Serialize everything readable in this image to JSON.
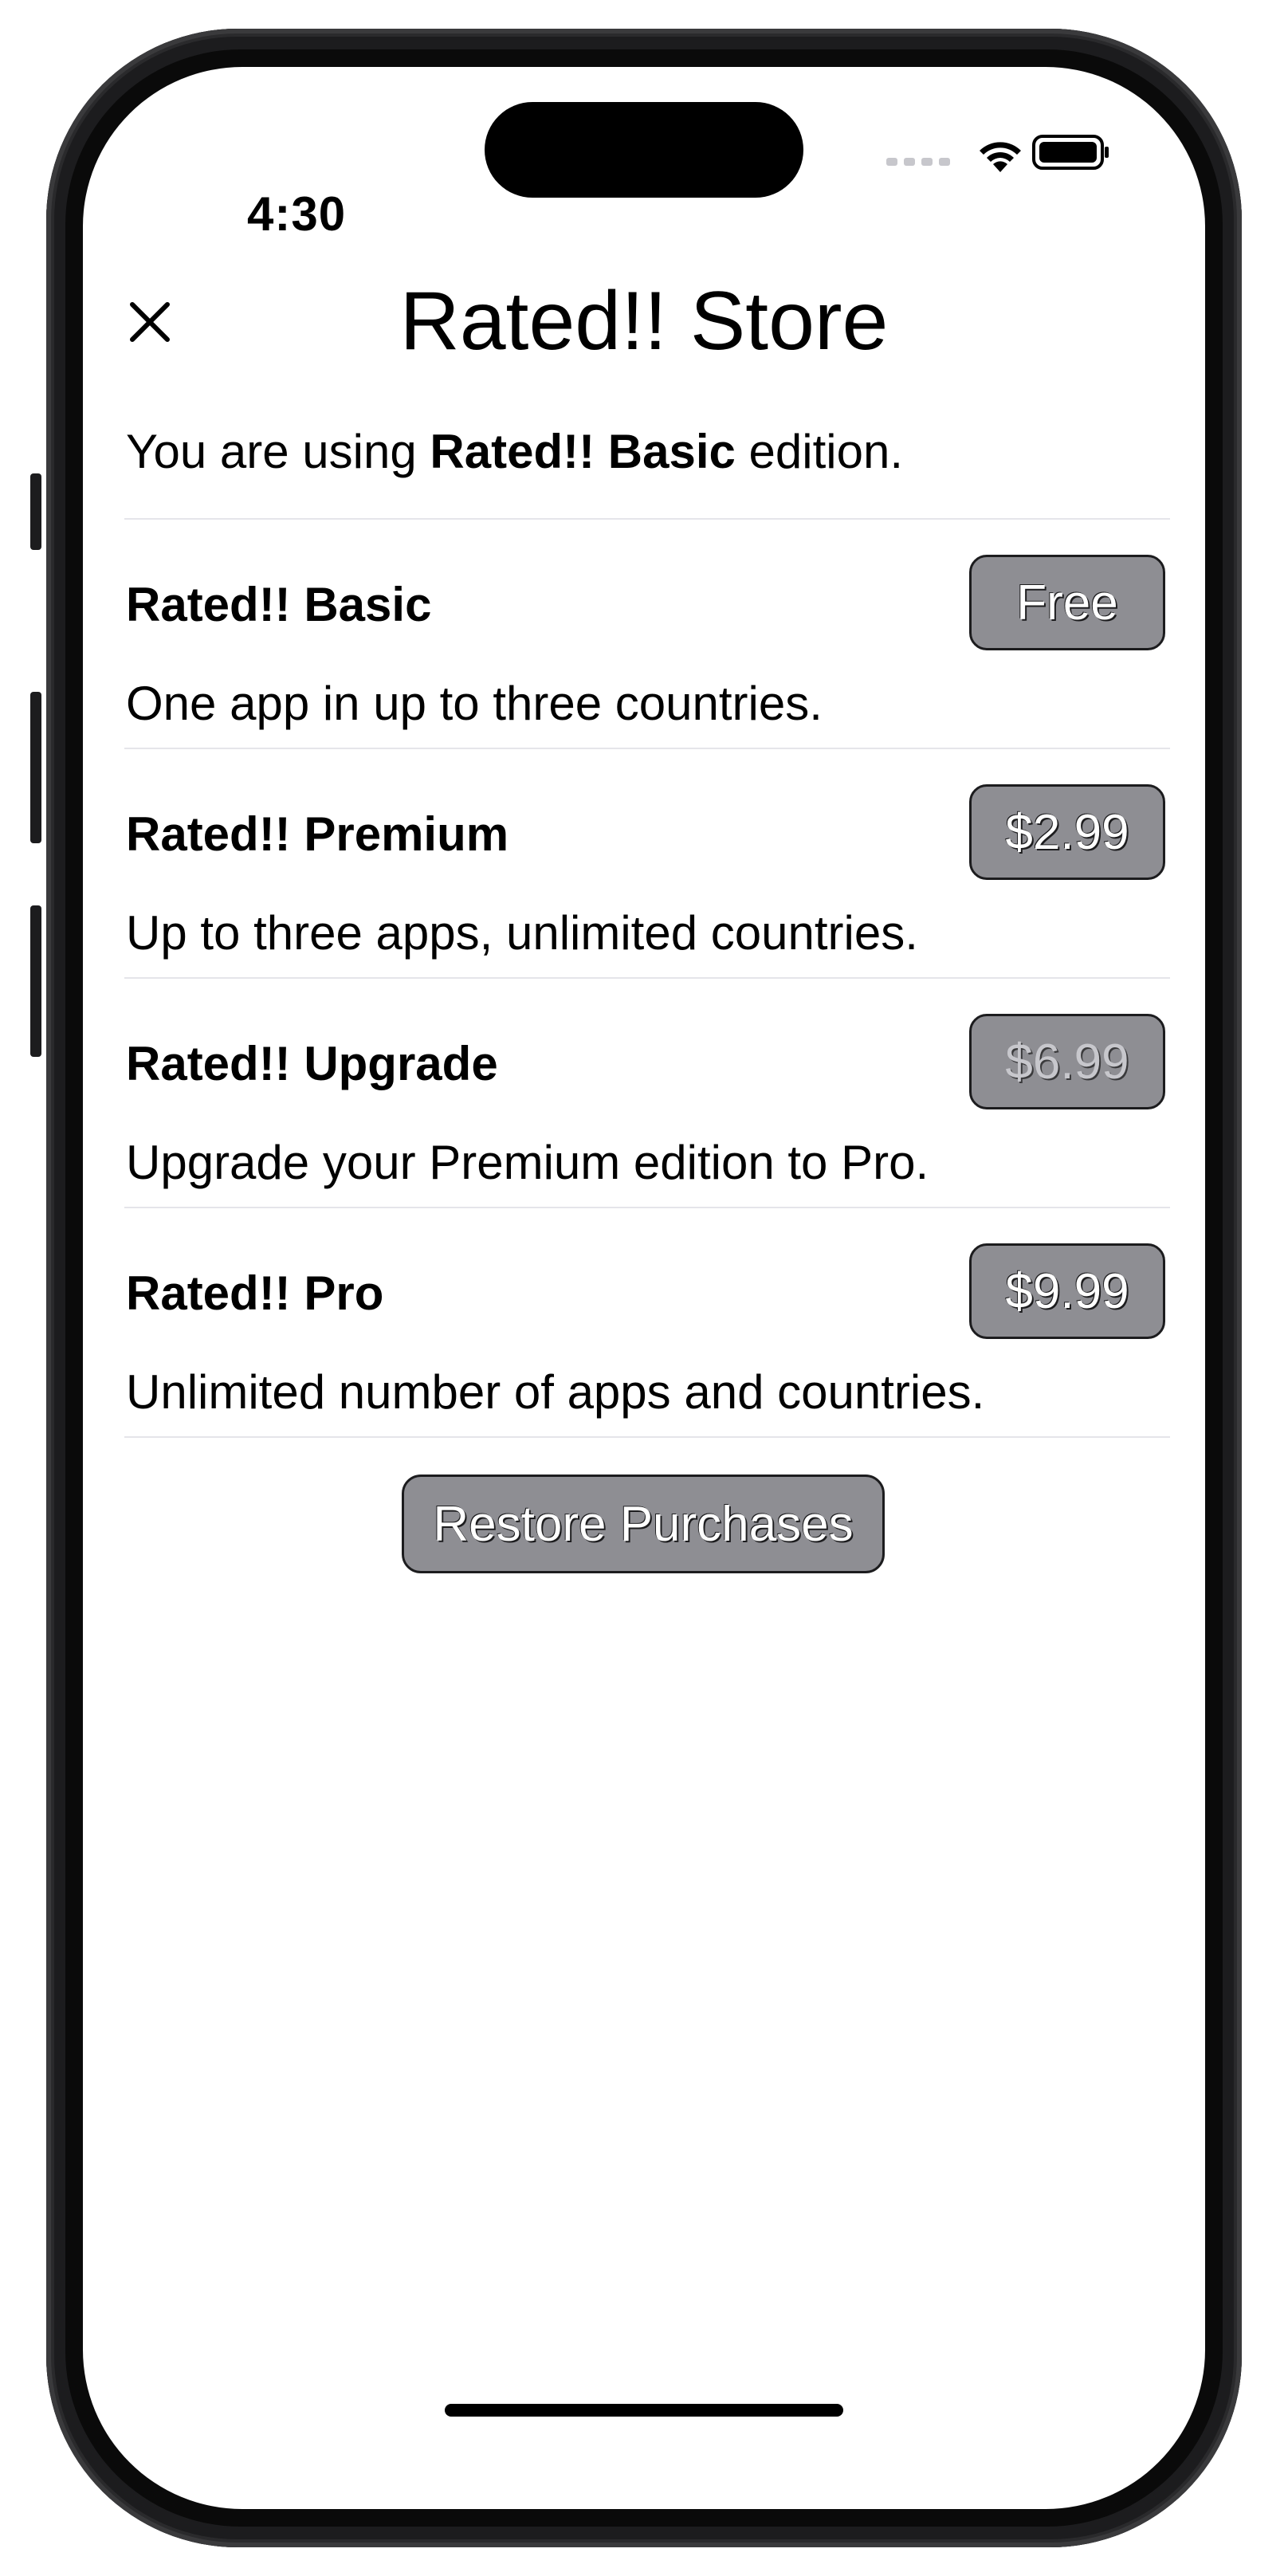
{
  "status_bar": {
    "time": "4:30",
    "wifi_icon": "wifi-icon",
    "battery_icon": "battery-icon"
  },
  "header": {
    "close_icon": "close-icon",
    "title": "Rated!! Store"
  },
  "current_edition": {
    "prefix": "You are using ",
    "edition": "Rated!! Basic",
    "suffix": " edition."
  },
  "products": [
    {
      "name": "Rated!! Basic",
      "description": "One app in up to three countries.",
      "price": "Free",
      "enabled": true
    },
    {
      "name": "Rated!! Premium",
      "description": "Up to three apps, unlimited countries.",
      "price": "$2.99",
      "enabled": true
    },
    {
      "name": "Rated!! Upgrade",
      "description": "Upgrade your Premium edition to Pro.",
      "price": "$6.99",
      "enabled": false
    },
    {
      "name": "Rated!! Pro",
      "description": "Unlimited number of apps and countries.",
      "price": "$9.99",
      "enabled": true
    }
  ],
  "restore_button": "Restore Purchases",
  "colors": {
    "button_fill": "#8e8e93",
    "button_border": "#1c1c1e",
    "divider": "#e5e5ea"
  }
}
